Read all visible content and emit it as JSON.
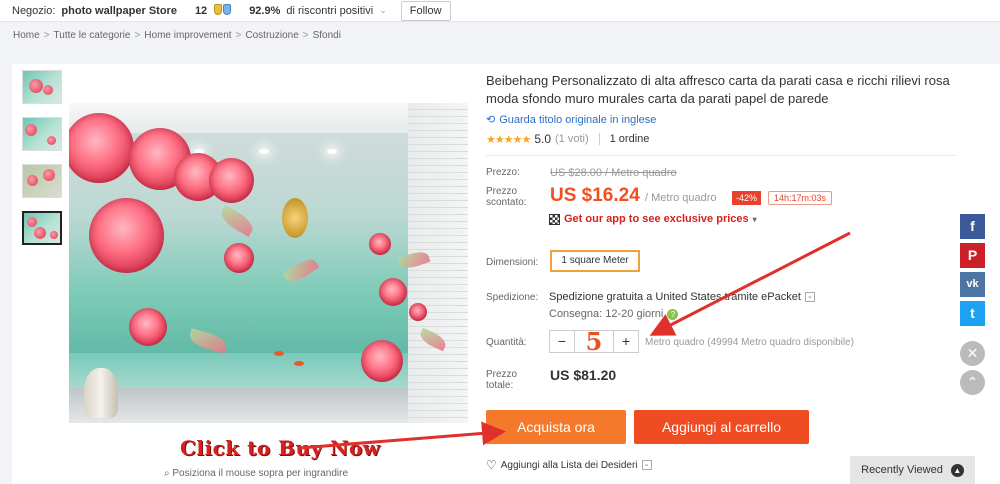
{
  "store": {
    "label": "Negozio:",
    "name": "photo wallpaper Store",
    "rating": "12",
    "positive_pct": "92.9%",
    "positive_text": "di riscontri positivi",
    "follow": "Follow"
  },
  "breadcrumb": [
    "Home",
    "Tutte le categorie",
    "Home improvement",
    "Costruzione",
    "Sfondi"
  ],
  "product": {
    "title": "Beibehang Personalizzato di alta affresco carta da parati casa e ricchi rilievi rosa moda sfondo muro murales carta da parati papel de parede",
    "translate_link": "Guarda titolo originale in inglese",
    "rating_value": "5.0",
    "votes": "(1 voti)",
    "orders": "1 ordine",
    "stars": "★★★★★"
  },
  "price": {
    "label": "Prezzo:",
    "original": "US $28.00 / Metro quadro",
    "sale_label": "Prezzo scontato:",
    "sale": "US $16.24",
    "unit": "/ Metro quadro",
    "discount": "-42%",
    "timer": "14h:17m:03s",
    "app_promo": "Get our app to see exclusive prices"
  },
  "options": {
    "dimension_label": "Dimensioni:",
    "dimension_value": "1 square Meter",
    "shipping_label": "Spedizione:",
    "shipping_value": "Spedizione gratuita a United States tramite ePacket",
    "delivery": "Consegna: 12-20 giorni",
    "quantity_label": "Quantità:",
    "quantity_minus": "−",
    "quantity_value": "5",
    "quantity_plus": "+",
    "quantity_note": "Metro quadro (49994 Metro quadro disponibile)",
    "total_label": "Prezzo totale:",
    "total_value": "US $81.20"
  },
  "actions": {
    "buy": "Acquista ora",
    "cart": "Aggiungi al carrello",
    "wishlist": "Aggiungi alla Lista dei Desideri"
  },
  "gallery": {
    "click_to_buy": "Click to Buy Now",
    "zoom_hint": "Posiziona il mouse sopra per ingrandire"
  },
  "sidebar": {
    "recently_viewed": "Recently Viewed"
  },
  "colors": {
    "accent": "#f44e1e",
    "buy": "#f4792a",
    "cart": "#f04c23",
    "facebook": "#3b5998",
    "pinterest": "#cb2027",
    "vk": "#4c75a3",
    "twitter": "#1da1f2"
  }
}
